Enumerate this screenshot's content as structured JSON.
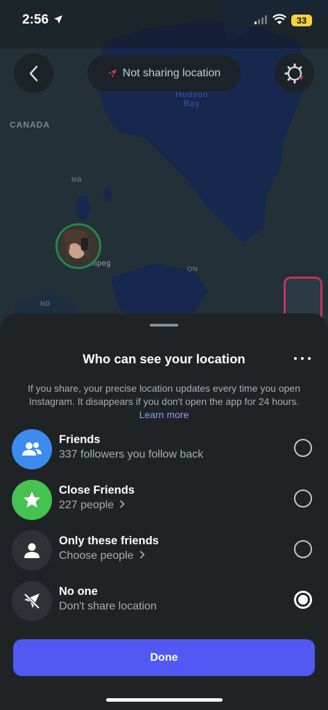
{
  "status_bar": {
    "time": "2:56",
    "battery": "33"
  },
  "map": {
    "labels": {
      "country": "CANADA",
      "bay": "Hudson\nBay",
      "province_mb": "MB",
      "province_on": "ON",
      "state_nd": "ND",
      "city": "nnipeg"
    }
  },
  "top_controls": {
    "sharing_status": "Not sharing location"
  },
  "sheet": {
    "title": "Who can see your location",
    "description": "If you share, your precise location updates every time you open Instagram. It disappears if you don't open the app for 24 hours.",
    "learn_more": "Learn more",
    "options": [
      {
        "title": "Friends",
        "subtitle": "337 followers you follow back",
        "selected": false,
        "icon": "friends-icon",
        "color": "#3d8bef"
      },
      {
        "title": "Close Friends",
        "subtitle": "227 people",
        "selected": false,
        "icon": "star-icon",
        "color": "#45c24f"
      },
      {
        "title": "Only these friends",
        "subtitle": "Choose people",
        "selected": false,
        "icon": "person-icon",
        "color": "#2e3236"
      },
      {
        "title": "No one",
        "subtitle": "Don't share location",
        "selected": true,
        "icon": "location-off-icon",
        "color": "#2e3236"
      }
    ],
    "done_label": "Done"
  }
}
